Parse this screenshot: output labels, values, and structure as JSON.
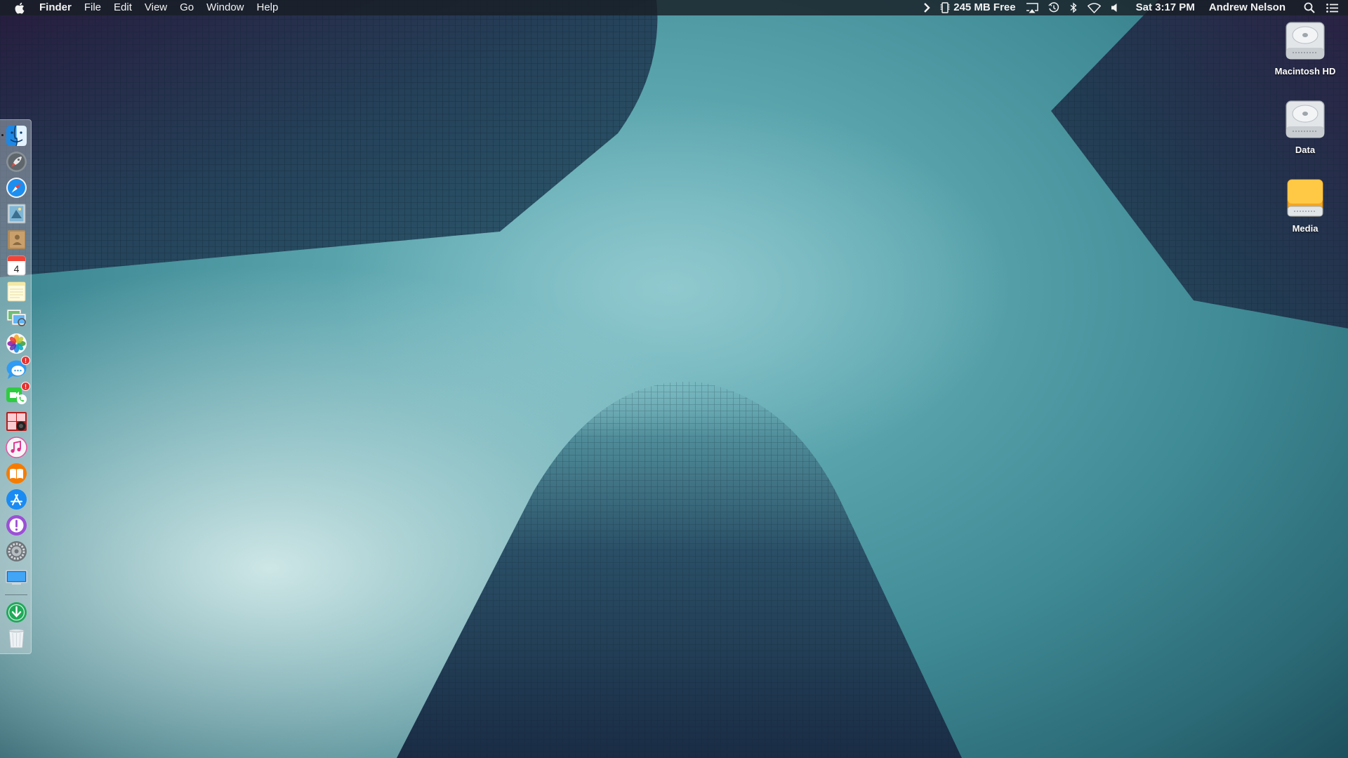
{
  "menubar": {
    "app_name": "Finder",
    "menus": [
      "File",
      "Edit",
      "View",
      "Go",
      "Window",
      "Help"
    ],
    "memory_status": "245 MB Free",
    "clock": "Sat 3:17 PM",
    "user_name": "Andrew Nelson"
  },
  "dock": {
    "apps": [
      {
        "name": "Finder",
        "running": true
      },
      {
        "name": "Launchpad"
      },
      {
        "name": "Safari"
      },
      {
        "name": "Mail"
      },
      {
        "name": "Contacts"
      },
      {
        "name": "Calendar",
        "date": "4"
      },
      {
        "name": "Notes"
      },
      {
        "name": "Preview"
      },
      {
        "name": "Photos"
      },
      {
        "name": "Messages",
        "badge": "!"
      },
      {
        "name": "FaceTime",
        "badge": "!"
      },
      {
        "name": "Photo Booth"
      },
      {
        "name": "iTunes"
      },
      {
        "name": "iBooks"
      },
      {
        "name": "App Store"
      },
      {
        "name": "Feedback Assistant"
      },
      {
        "name": "System Preferences"
      },
      {
        "name": "Desktop"
      },
      {
        "name": "Downloads"
      },
      {
        "name": "Trash"
      }
    ]
  },
  "desktop_icons": [
    {
      "label": "Macintosh HD",
      "kind": "internal-drive"
    },
    {
      "label": "Data",
      "kind": "internal-drive"
    },
    {
      "label": "Media",
      "kind": "external-drive"
    }
  ],
  "colors": {
    "menubar_bg": "#191e26",
    "menubar_text": "#f2f2f2",
    "sky": "#5aa4ad",
    "tower": "#1b3a4c",
    "external_drive": "#f5a623"
  }
}
